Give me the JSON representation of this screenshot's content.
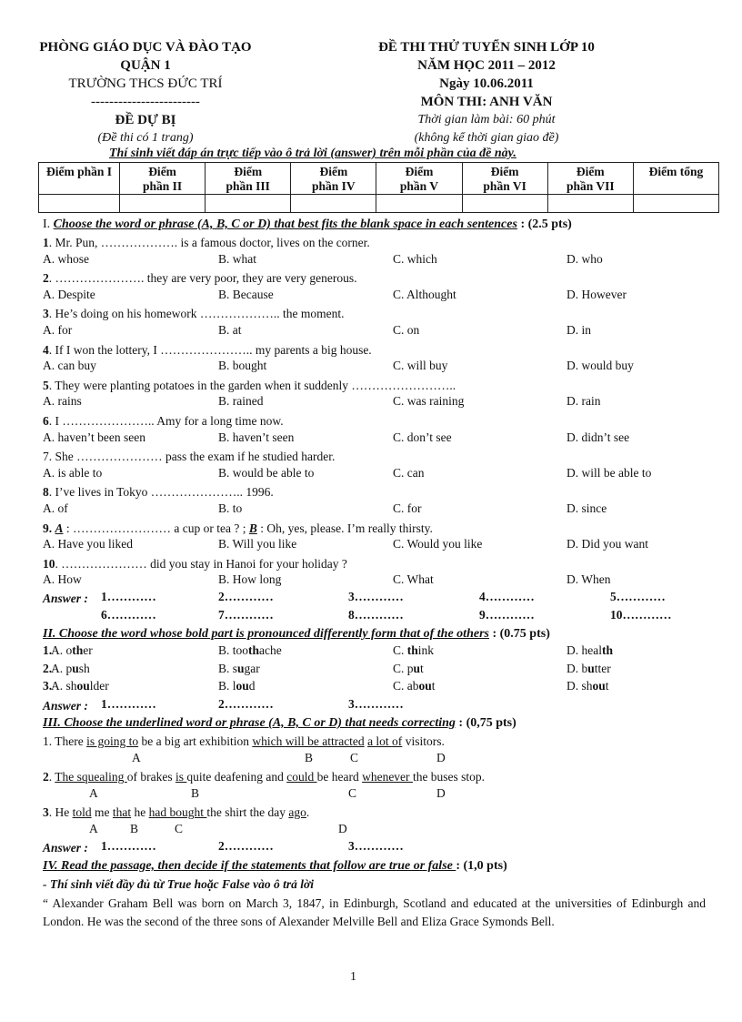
{
  "header_left": {
    "line1": "PHÒNG GIÁO DỤC VÀ ĐÀO TẠO",
    "line2": "QUẬN 1",
    "line3": "TRƯỜNG THCS ĐỨC TRÍ",
    "divider": "------------------------",
    "line4": "ĐỀ DỰ BỊ",
    "line5": "(Đề thi có 1 trang)"
  },
  "header_right": {
    "line1": "ĐỀ THI THỬ TUYỂN SINH LỚP 10",
    "line2": "NĂM HỌC 2011 – 2012",
    "line3": "Ngày 10.06.2011",
    "line4": "MÔN THI: ANH VĂN",
    "line5": "Thời gian làm bài: 60 phút",
    "line6": "(không kể thời gian giao đề)"
  },
  "instruction": "Thí sinh viết đáp án trực tiếp vào ô trả lời (answer) trên mỗi phần của đề này.",
  "score_table": {
    "headers": [
      [
        "Điểm phần I",
        ""
      ],
      [
        "Điểm",
        "phần II"
      ],
      [
        "Điểm",
        "phần III"
      ],
      [
        "Điểm",
        "phần IV"
      ],
      [
        "Điểm",
        "phần V"
      ],
      [
        "Điểm",
        "phần VI"
      ],
      [
        "Điểm",
        "phần VII"
      ],
      [
        "Điểm tổng",
        ""
      ]
    ]
  },
  "section1": {
    "prefix": "I. ",
    "title": "Choose the word or phrase (A, B, C or D) that best fits the blank space in each sentences",
    "points": " : (2.5 pts)",
    "questions": [
      {
        "num": "1",
        "text": ". Mr. Pun, ………………. is a famous  doctor, lives   on the  corner.",
        "options": [
          "A. whose",
          "B. what",
          "C. which",
          "D. who"
        ]
      },
      {
        "num": "2",
        "text": ". …………………. they  are very  poor, they  are very generous.",
        "options": [
          "A. Despite",
          "B. Because",
          "C. Althought",
          "D. However"
        ]
      },
      {
        "num": "3",
        "text": ". He’s doing  on his homework  ……………….. the moment.",
        "options": [
          "A. for",
          "B. at",
          "C. on",
          "D. in"
        ]
      },
      {
        "num": "4",
        "text": ". If I won the lottery,  I ………………….. my parents  a big house.",
        "options": [
          "A. can buy",
          "B. bought",
          "C. will  buy",
          "D. would  buy"
        ]
      },
      {
        "num": "5",
        "text": ". They  were planting  potatoes in the  garden when it suddenly  ……………………..",
        "options": [
          "A. rains",
          "B. rained",
          "C. was raining",
          "D. rain"
        ]
      },
      {
        "num": "6",
        "text": ". I ………………….. Amy  for  a long  time  now.",
        "options": [
          "A. haven’t  been seen",
          "B. haven’t  seen",
          "C. don’t see",
          "D. didn’t  see"
        ]
      },
      {
        "num": "7",
        "text": ". She ………………… pass the exam  if he studied  harder.",
        "options": [
          "A. is able to",
          "B. would  be able to",
          "C. can",
          "D. will  be able to"
        ]
      },
      {
        "num": "8",
        "text": ". I’ve lives  in Tokyo  ………………….. 1996.",
        "options": [
          "A. of",
          "B. to",
          "C. for",
          "D. since"
        ]
      },
      {
        "num": "9",
        "text_a": "A",
        "text": " : …………………… a cup or tea ?       ;      ",
        "text_b": "B",
        "text_end": " : Oh, yes, please.  I’m really  thirsty.",
        "options": [
          "A. Have you liked",
          "B. Will  you like",
          "C. Would you like",
          "D. Did you want"
        ]
      },
      {
        "num": "10",
        "text": ". ………………… did you stay  in  Hanoi  for your  holiday  ?",
        "options": [
          "A. How",
          "B. How long",
          "C. What",
          "D. When"
        ]
      }
    ],
    "answer_label": "Answer :",
    "answer_slots": [
      "1…………",
      "2…………",
      "3…………",
      "4…………",
      "5…………",
      "6…………",
      "7…………",
      "8…………",
      "9…………",
      "10…………"
    ]
  },
  "section2": {
    "title": "II. Choose the word whose bold part is pronounced differently form that of the others",
    "points": " : (0.75 pts)",
    "questions": [
      {
        "num": "1",
        "options": [
          [
            "A. o",
            "th",
            "er"
          ],
          [
            "B. too",
            "th",
            "ache"
          ],
          [
            "C. ",
            "th",
            "ink"
          ],
          [
            "D. heal",
            "th",
            ""
          ]
        ]
      },
      {
        "num": "2",
        "options": [
          [
            "A. p",
            "u",
            "sh"
          ],
          [
            "B. s",
            "u",
            "gar"
          ],
          [
            "C. p",
            "u",
            "t"
          ],
          [
            "D. b",
            "u",
            "tter"
          ]
        ]
      },
      {
        "num": "3",
        "options": [
          [
            "A. sh",
            "ou",
            "lder"
          ],
          [
            "B. l",
            "ou",
            "d"
          ],
          [
            "C. ab",
            "ou",
            "t"
          ],
          [
            "D. sh",
            "ou",
            "t"
          ]
        ]
      }
    ],
    "answer_label": "Answer :",
    "answer_slots": [
      "1…………",
      "2…………",
      "3…………"
    ]
  },
  "section3": {
    "title": "III. Choose the underlined word or phrase (A, B, C or D) that needs correcting",
    "points": " : (0,75 pts)",
    "questions": [
      {
        "num": "1",
        "segments": [
          ". There ",
          "is going  to",
          " be a big  art exhibition   ",
          "which ",
          " ",
          "will  be attracted",
          " ",
          "a lot of",
          " visitors."
        ],
        "letters": [
          "A",
          "B",
          "C",
          "D"
        ]
      },
      {
        "num": "2",
        "segments": [
          ". ",
          "The  squealing ",
          "  of brakes ",
          "is ",
          " quite  deafening   and ",
          "could ",
          " be heard ",
          "whenever ",
          " the  buses  stop."
        ],
        "letters": [
          "A",
          "B",
          "C",
          "D"
        ]
      },
      {
        "num": "3",
        "segments": [
          ". He ",
          "told",
          " me ",
          "that",
          " he ",
          "had bought ",
          " the shirt  the day ",
          "ago",
          "."
        ],
        "letters": [
          "A",
          "B",
          "C",
          "D"
        ]
      }
    ],
    "answer_label": "Answer :",
    "answer_slots": [
      "1…………",
      "2…………",
      "3…………"
    ]
  },
  "section4": {
    "title": "IV. Read the passage,  then decide if the statements that follow are true  or false ",
    "points": " : (1,0 pts)",
    "subtitle": "- Thí sinh viết đầy đủ từ True hoặc False vào ô trả lời",
    "passage": "“     Alexander  Graham  Bell  was  born  on  March  3,  1847,  in  Edinburgh,   Scotland  and  educated  at  the universities   of Edinburgh   and London.  He was the  second of the  three  sons of Alexander  Melville   Bell  and Eliza Grace Symonds  Bell."
  },
  "page_number": "1"
}
